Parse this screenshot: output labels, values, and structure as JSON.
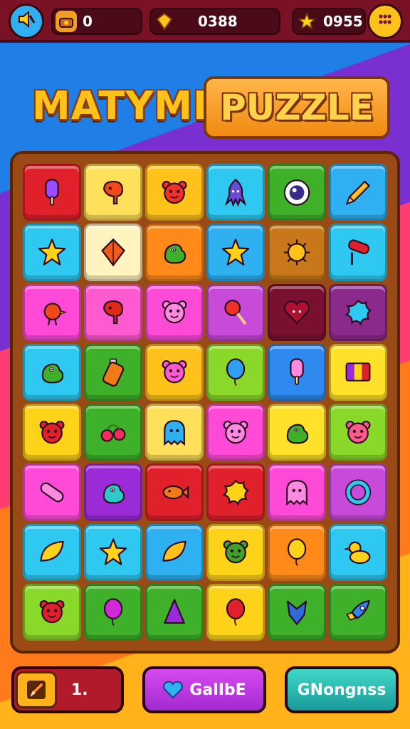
{
  "hud": {
    "coins": "0",
    "gems": "0388",
    "stars": "0955"
  },
  "title": {
    "left": "MATYME",
    "right": "PUZZLE"
  },
  "board": {
    "rows": [
      [
        {
          "bg": "#e0202a",
          "icon": "popsicle-icon",
          "fg": "#9b4dff"
        },
        {
          "bg": "#ffe05a",
          "icon": "elephant-icon",
          "fg": "#f04a1a"
        },
        {
          "bg": "#ffc21a",
          "icon": "bear-face-icon",
          "fg": "#f0302a"
        },
        {
          "bg": "#2fc8f0",
          "icon": "squid-icon",
          "fg": "#6a4ad8"
        },
        {
          "bg": "#3fb02a",
          "icon": "eye-icon",
          "fg": "#3a2a8a"
        },
        {
          "bg": "#2fb0f0",
          "icon": "pencil-icon",
          "fg": "#ffc21a"
        }
      ],
      [
        {
          "bg": "#2fc8f0",
          "icon": "star-icon",
          "fg": "#ffd21a"
        },
        {
          "bg": "#fff3c0",
          "icon": "kite-icon",
          "fg": "#f05a1a"
        },
        {
          "bg": "#ff8a1a",
          "icon": "dino-icon",
          "fg": "#3fb02a"
        },
        {
          "bg": "#2fb0f0",
          "icon": "star-icon",
          "fg": "#ffd21a"
        },
        {
          "bg": "#c8781a",
          "icon": "sun-icon",
          "fg": "#ffc21a"
        },
        {
          "bg": "#2fc8f0",
          "icon": "roller-icon",
          "fg": "#e0202a"
        }
      ],
      [
        {
          "bg": "#ff4ad8",
          "icon": "bird-icon",
          "fg": "#f04a1a"
        },
        {
          "bg": "#ff5ad0",
          "icon": "elephant-icon",
          "fg": "#e02a1a"
        },
        {
          "bg": "#ff4ad8",
          "icon": "bear-face-icon",
          "fg": "#ff8ae0"
        },
        {
          "bg": "#c84ad8",
          "icon": "lollipop-icon",
          "fg": "#f0302a"
        },
        {
          "bg": "#7a1030",
          "icon": "heart-face-icon",
          "fg": "#b01030"
        },
        {
          "bg": "#8a2a8a",
          "icon": "splat-icon",
          "fg": "#2fc8f0"
        }
      ],
      [
        {
          "bg": "#2fc8f0",
          "icon": "dino-icon",
          "fg": "#3fb02a"
        },
        {
          "bg": "#3fb02a",
          "icon": "bottle-icon",
          "fg": "#f07a1a"
        },
        {
          "bg": "#ffc21a",
          "icon": "bear-face-icon",
          "fg": "#ff5ad0"
        },
        {
          "bg": "#8ad82a",
          "icon": "balloon-icon",
          "fg": "#2fa0f0"
        },
        {
          "bg": "#2f8af0",
          "icon": "popsicle-icon",
          "fg": "#ff8ae0"
        },
        {
          "bg": "#ffe02a",
          "icon": "flag-stripes-icon",
          "fg": "#9b2ad8"
        }
      ],
      [
        {
          "bg": "#ffd21a",
          "icon": "bear-face-icon",
          "fg": "#e0202a"
        },
        {
          "bg": "#3fb02a",
          "icon": "cherries-icon",
          "fg": "#f0305a"
        },
        {
          "bg": "#ffe05a",
          "icon": "ghost-icon",
          "fg": "#2fb0f0"
        },
        {
          "bg": "#ff4ad8",
          "icon": "bear-face-icon",
          "fg": "#ff8ae0"
        },
        {
          "bg": "#ffe02a",
          "icon": "dino-icon",
          "fg": "#3fb02a"
        },
        {
          "bg": "#8ad82a",
          "icon": "bear-face-icon",
          "fg": "#ff5a8a"
        }
      ],
      [
        {
          "bg": "#ff4ad8",
          "icon": "capsule-icon",
          "fg": "#ff8ae0"
        },
        {
          "bg": "#9b2ad8",
          "icon": "dino-icon",
          "fg": "#2fc8c8"
        },
        {
          "bg": "#e0202a",
          "icon": "fish-icon",
          "fg": "#f07a1a"
        },
        {
          "bg": "#e0202a",
          "icon": "splat-icon",
          "fg": "#ffd21a"
        },
        {
          "bg": "#ff4ad8",
          "icon": "ghost-icon",
          "fg": "#ff8ae0"
        },
        {
          "bg": "#c84ad8",
          "icon": "ring-icon",
          "fg": "#2fc8f0"
        }
      ],
      [
        {
          "bg": "#2fc8f0",
          "icon": "leaf-icon",
          "fg": "#ffd21a"
        },
        {
          "bg": "#2fc8f0",
          "icon": "star-icon",
          "fg": "#ffd21a"
        },
        {
          "bg": "#2fb0f0",
          "icon": "leaf-icon",
          "fg": "#ffc21a"
        },
        {
          "bg": "#ffd21a",
          "icon": "bear-face-icon",
          "fg": "#3fa02a"
        },
        {
          "bg": "#ff8a1a",
          "icon": "balloon-icon",
          "fg": "#ffd21a"
        },
        {
          "bg": "#2fc8f0",
          "icon": "duck-icon",
          "fg": "#ffd21a"
        }
      ],
      [
        {
          "bg": "#8ad82a",
          "icon": "bear-face-icon",
          "fg": "#e0202a"
        },
        {
          "bg": "#3fb02a",
          "icon": "balloon-icon",
          "fg": "#d02ad8"
        },
        {
          "bg": "#3fb02a",
          "icon": "cone-icon",
          "fg": "#9b2ad8"
        },
        {
          "bg": "#ffd21a",
          "icon": "balloon-icon",
          "fg": "#e0202a"
        },
        {
          "bg": "#3fb02a",
          "icon": "shield-icon",
          "fg": "#2f6ad8"
        },
        {
          "bg": "#3fb02a",
          "icon": "rocket-icon",
          "fg": "#2f8af0"
        }
      ]
    ]
  },
  "bottom": {
    "left_label": "1.",
    "middle_label": "GalIbE",
    "right_label": "GNongnss"
  }
}
